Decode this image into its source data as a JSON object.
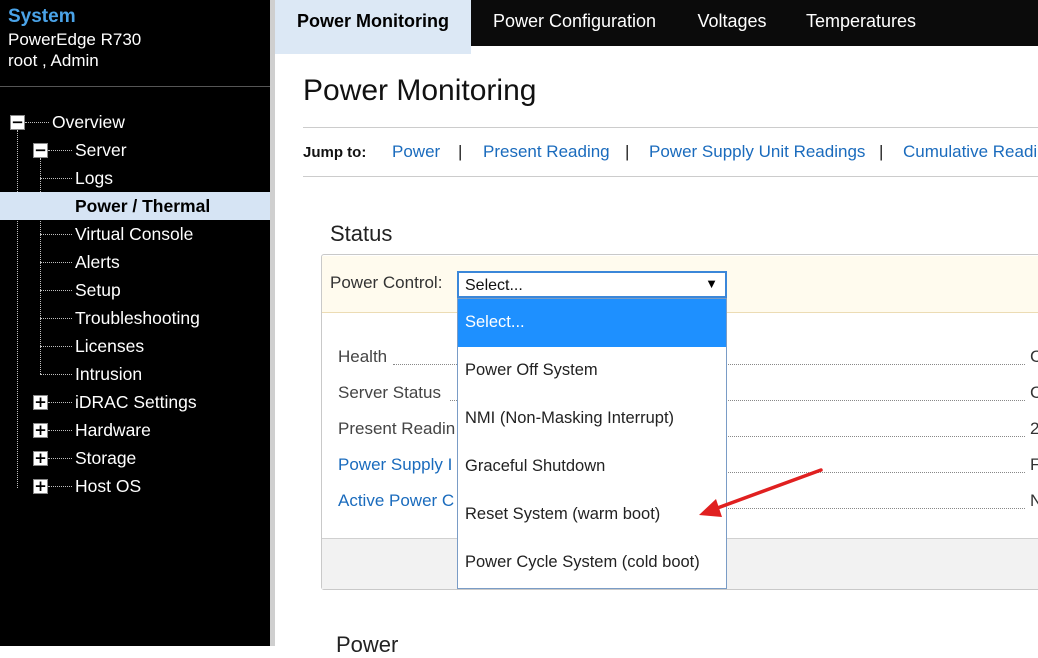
{
  "system": {
    "title": "System",
    "model": "PowerEdge R730",
    "user": "root , Admin"
  },
  "tree": {
    "items": [
      {
        "label": "Overview",
        "toggle": "−"
      },
      {
        "label": "Server",
        "toggle": "−"
      },
      {
        "label": "Logs"
      },
      {
        "label": "Power / Thermal",
        "selected": true
      },
      {
        "label": "Virtual Console"
      },
      {
        "label": "Alerts"
      },
      {
        "label": "Setup"
      },
      {
        "label": "Troubleshooting"
      },
      {
        "label": "Licenses"
      },
      {
        "label": "Intrusion"
      },
      {
        "label": "iDRAC Settings",
        "toggle": "+"
      },
      {
        "label": "Hardware",
        "toggle": "+"
      },
      {
        "label": "Storage",
        "toggle": "+"
      },
      {
        "label": "Host OS",
        "toggle": "+"
      }
    ]
  },
  "tabs": [
    {
      "label": "Power Monitoring",
      "active": true
    },
    {
      "label": "Power Configuration"
    },
    {
      "label": "Voltages"
    },
    {
      "label": "Temperatures"
    }
  ],
  "page": {
    "title": "Power Monitoring"
  },
  "jump": {
    "label": "Jump to:",
    "separator": "|",
    "links": [
      "Power",
      "Present Reading",
      "Power Supply Unit Readings",
      "Cumulative Readin"
    ]
  },
  "status": {
    "heading": "Status",
    "power_control_label": "Power Control:",
    "select_value": "Select...",
    "select_caret": "▼",
    "rows": [
      {
        "label": "Health",
        "value": "C"
      },
      {
        "label": "Server Status",
        "value": "C"
      },
      {
        "label": "Present Readin",
        "value": "2"
      },
      {
        "label": "Power Supply I",
        "value": "F"
      },
      {
        "label": "Active Power C",
        "value": "N"
      }
    ]
  },
  "dropdown": {
    "options": [
      {
        "label": "Select...",
        "highlighted": true
      },
      {
        "label": "Power Off System"
      },
      {
        "label": "NMI (Non-Masking Interrupt)"
      },
      {
        "label": "Graceful Shutdown"
      },
      {
        "label": "Reset System (warm boot)"
      },
      {
        "label": "Power Cycle System (cold boot)"
      }
    ]
  },
  "power_section": {
    "heading": "Power"
  },
  "colors": {
    "accent_blue": "#1e90ff",
    "link_blue": "#1a6bbd",
    "annotation_arrow": "#e02020",
    "sidebar_bg": "#000000",
    "selected_bg": "#d6e4f4"
  },
  "annotation": {
    "icon": "red-arrow-icon"
  }
}
